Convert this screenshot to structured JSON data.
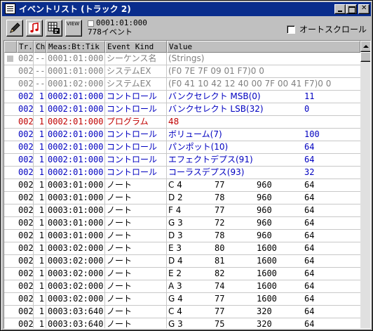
{
  "window": {
    "title": "イベントリスト (トラック 2)"
  },
  "toolbar": {
    "view_label": "VIEW",
    "position": "0001:01:000",
    "event_count": "778イベント",
    "autoscroll_label": "オートスクロール",
    "autoscroll_checked": false
  },
  "columns": [
    "Tr.",
    "Ch",
    "Meas:Bt:Tik",
    "Event Kind",
    "Value"
  ],
  "colors": {
    "meta": "#808080",
    "control": "#0000c0",
    "program": "#c00000",
    "note": "#000000",
    "title_bar": "#0a2d8c"
  },
  "rows": [
    {
      "tr": "002",
      "ch": "--",
      "meas": "0001:01:000",
      "kind": "シーケンス名",
      "v1": "(Strings)",
      "v2": "",
      "v3": "",
      "v4": "",
      "style": "meta",
      "marked": true
    },
    {
      "tr": "002",
      "ch": "--",
      "meas": "0001:01:000",
      "kind": "システムEX",
      "v1": "(F0 7E 7F 09 01 F7)0 0",
      "v2": "",
      "v3": "",
      "v4": "",
      "style": "meta",
      "marked": false
    },
    {
      "tr": "002",
      "ch": "--",
      "meas": "0001:02:000",
      "kind": "システムEX",
      "v1": "(F0 41 10 42 12 40 00 7F 00 41 F7)0 0",
      "v2": "",
      "v3": "",
      "v4": "",
      "style": "meta",
      "marked": false
    },
    {
      "tr": "002",
      "ch": "1",
      "meas": "0002:01:000",
      "kind": "コントロール",
      "v1": "バンクセレクト MSB(0)",
      "v2": "",
      "v3": "",
      "v4": "11",
      "style": "blue",
      "marked": false
    },
    {
      "tr": "002",
      "ch": "1",
      "meas": "0002:01:000",
      "kind": "コントロール",
      "v1": "バンクセレクト LSB(32)",
      "v2": "",
      "v3": "",
      "v4": "0",
      "style": "blue",
      "marked": false
    },
    {
      "tr": "002",
      "ch": "1",
      "meas": "0002:01:000",
      "kind": "プログラム",
      "v1": "48",
      "v2": "",
      "v3": "",
      "v4": "",
      "style": "red",
      "marked": false
    },
    {
      "tr": "002",
      "ch": "1",
      "meas": "0002:01:000",
      "kind": "コントロール",
      "v1": "ボリューム(7)",
      "v2": "",
      "v3": "",
      "v4": "100",
      "style": "blue",
      "marked": false
    },
    {
      "tr": "002",
      "ch": "1",
      "meas": "0002:01:000",
      "kind": "コントロール",
      "v1": "パンポット(10)",
      "v2": "",
      "v3": "",
      "v4": "64",
      "style": "blue",
      "marked": false
    },
    {
      "tr": "002",
      "ch": "1",
      "meas": "0002:01:000",
      "kind": "コントロール",
      "v1": "エフェクトデプス(91)",
      "v2": "",
      "v3": "",
      "v4": "64",
      "style": "blue",
      "marked": false
    },
    {
      "tr": "002",
      "ch": "1",
      "meas": "0002:01:000",
      "kind": "コントロール",
      "v1": "コーラスデプス(93)",
      "v2": "",
      "v3": "",
      "v4": "32",
      "style": "blue",
      "marked": false
    },
    {
      "tr": "002",
      "ch": "1",
      "meas": "0003:01:000",
      "kind": "ノート",
      "v1": "C 4",
      "v2": "77",
      "v3": "960",
      "v4": "64",
      "style": "black",
      "marked": false
    },
    {
      "tr": "002",
      "ch": "1",
      "meas": "0003:01:000",
      "kind": "ノート",
      "v1": "D 2",
      "v2": "78",
      "v3": "960",
      "v4": "64",
      "style": "black",
      "marked": false
    },
    {
      "tr": "002",
      "ch": "1",
      "meas": "0003:01:000",
      "kind": "ノート",
      "v1": "F 4",
      "v2": "77",
      "v3": "960",
      "v4": "64",
      "style": "black",
      "marked": false
    },
    {
      "tr": "002",
      "ch": "1",
      "meas": "0003:01:000",
      "kind": "ノート",
      "v1": "G 3",
      "v2": "72",
      "v3": "960",
      "v4": "64",
      "style": "black",
      "marked": false
    },
    {
      "tr": "002",
      "ch": "1",
      "meas": "0003:01:000",
      "kind": "ノート",
      "v1": "D 3",
      "v2": "78",
      "v3": "960",
      "v4": "64",
      "style": "black",
      "marked": false
    },
    {
      "tr": "002",
      "ch": "1",
      "meas": "0003:02:000",
      "kind": "ノート",
      "v1": "E 3",
      "v2": "80",
      "v3": "1600",
      "v4": "64",
      "style": "black",
      "marked": false
    },
    {
      "tr": "002",
      "ch": "1",
      "meas": "0003:02:000",
      "kind": "ノート",
      "v1": "D 4",
      "v2": "81",
      "v3": "1600",
      "v4": "64",
      "style": "black",
      "marked": false
    },
    {
      "tr": "002",
      "ch": "1",
      "meas": "0003:02:000",
      "kind": "ノート",
      "v1": "E 2",
      "v2": "82",
      "v3": "1600",
      "v4": "64",
      "style": "black",
      "marked": false
    },
    {
      "tr": "002",
      "ch": "1",
      "meas": "0003:02:000",
      "kind": "ノート",
      "v1": "A 3",
      "v2": "74",
      "v3": "1600",
      "v4": "64",
      "style": "black",
      "marked": false
    },
    {
      "tr": "002",
      "ch": "1",
      "meas": "0003:02:000",
      "kind": "ノート",
      "v1": "G 4",
      "v2": "77",
      "v3": "1600",
      "v4": "64",
      "style": "black",
      "marked": false
    },
    {
      "tr": "002",
      "ch": "1",
      "meas": "0003:03:640",
      "kind": "ノート",
      "v1": "C 4",
      "v2": "77",
      "v3": "320",
      "v4": "64",
      "style": "black",
      "marked": false
    },
    {
      "tr": "002",
      "ch": "1",
      "meas": "0003:03:640",
      "kind": "ノート",
      "v1": "G 3",
      "v2": "75",
      "v3": "320",
      "v4": "64",
      "style": "black",
      "marked": false
    }
  ]
}
